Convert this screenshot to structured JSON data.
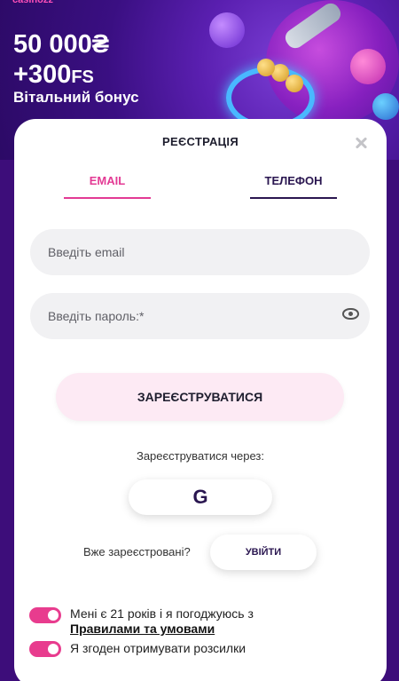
{
  "hero": {
    "logo_text": "casinozz",
    "amount": "50 000₴",
    "fs_value": "+300",
    "fs_unit": "FS",
    "bonus_label": "Вітальний бонус"
  },
  "modal": {
    "title": "РЕЄСТРАЦІЯ",
    "tabs": [
      {
        "label": "EMAIL",
        "active": true
      },
      {
        "label": "ТЕЛЕФОН",
        "active": false
      }
    ],
    "email_placeholder": "Введіть email",
    "password_placeholder": "Введіть пароль:*",
    "submit_label": "ЗАРЕЄСТРУВАТИСЯ",
    "via_label": "Зареєструватися через:",
    "google_label": "G",
    "already_label": "Вже зареєстровані?",
    "login_label": "УВІЙТИ",
    "consent_age_text": "Мені є 21 років і я погоджуюсь з",
    "consent_terms_link": "Правилами та умовами",
    "consent_mailing_text": "Я згоден отримувати розсилки"
  },
  "colors": {
    "accent_pink": "#e33a94",
    "dark_purple": "#2a1650",
    "background": "#3d0d7a"
  },
  "icons": [
    "close-icon",
    "eye-icon",
    "google-icon"
  ]
}
